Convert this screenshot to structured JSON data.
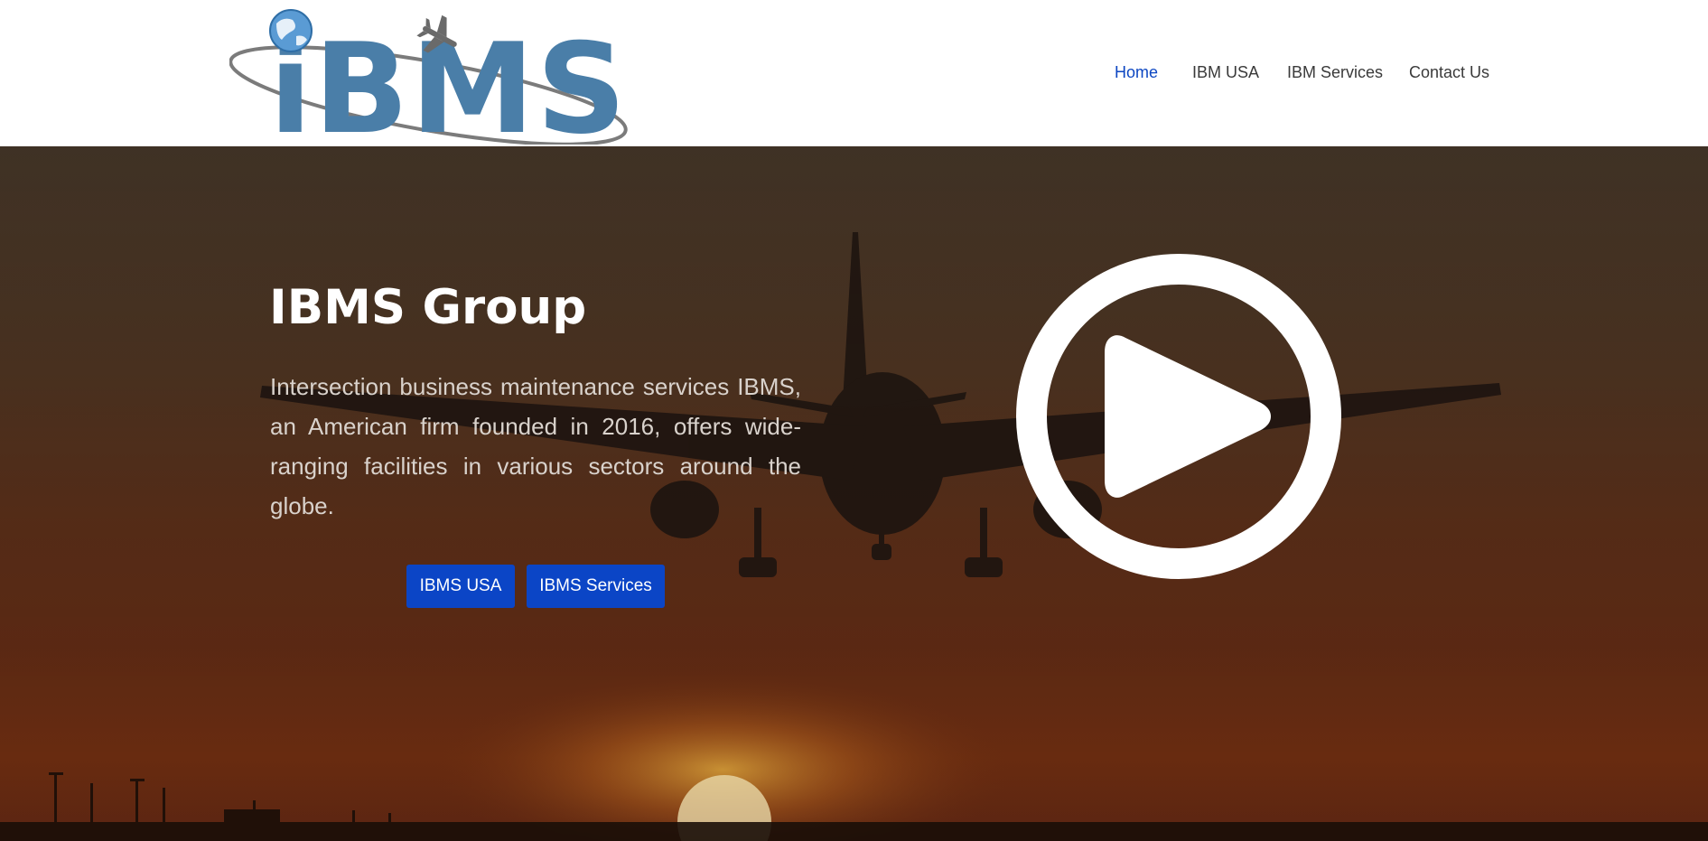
{
  "brand": {
    "logo_text": "iBMS"
  },
  "nav": {
    "items": [
      {
        "label": "Home"
      },
      {
        "label": "IBM USA"
      },
      {
        "label": "IBM Services"
      },
      {
        "label": "Contact Us"
      }
    ],
    "active": "Home"
  },
  "hero": {
    "title": "IBMS Group",
    "description": "Intersection business maintenance services IBMS, an American firm founded in 2016, offers wide-ranging facilities in various sectors around the globe.",
    "buttons": {
      "usa_label": "IBMS USA",
      "services_label": "IBMS Services"
    },
    "play_icon": "play-circle-icon"
  },
  "colors": {
    "nav_active": "#0d47c2",
    "nav_text": "#3a3a3a",
    "button_bg": "#0b45c6",
    "logo_blue": "#4a7ea8",
    "hero_overlay": "#4f3623"
  }
}
